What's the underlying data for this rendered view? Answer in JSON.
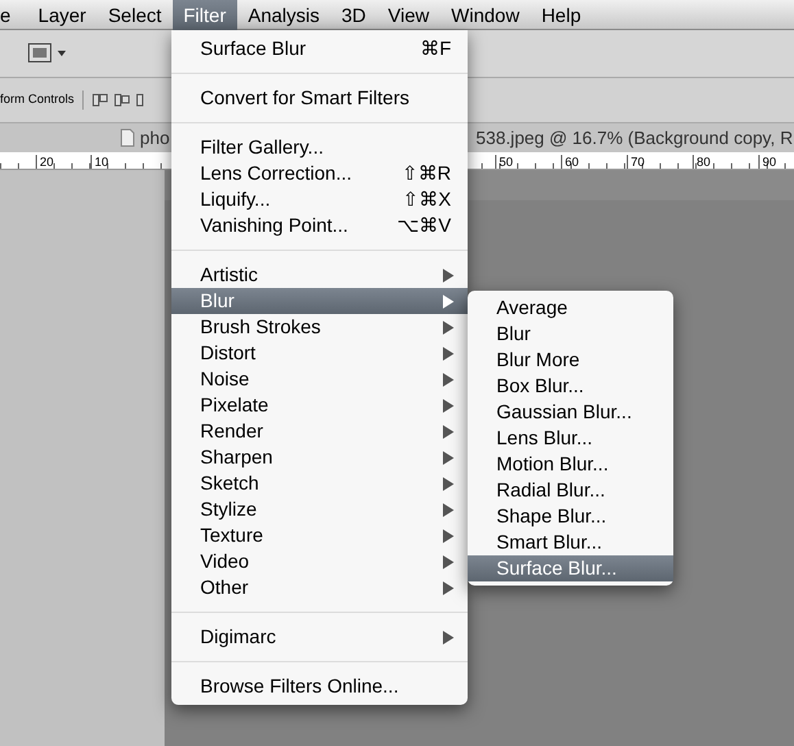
{
  "menu_bar": [
    {
      "label": "e",
      "selected": false
    },
    {
      "label": "Layer",
      "selected": false
    },
    {
      "label": "Select",
      "selected": false
    },
    {
      "label": "Filter",
      "selected": true
    },
    {
      "label": "Analysis",
      "selected": false
    },
    {
      "label": "3D",
      "selected": false
    },
    {
      "label": "View",
      "selected": false
    },
    {
      "label": "Window",
      "selected": false
    },
    {
      "label": "Help",
      "selected": false
    }
  ],
  "options_bar": {
    "label": "form Controls"
  },
  "document_tab": {
    "title_start": "pho",
    "title_end": "538.jpeg @ 16.7% (Background copy, R"
  },
  "ruler": {
    "left_labels": [
      "20",
      "10"
    ],
    "right_labels": [
      "50",
      "60",
      "70",
      "80",
      "90"
    ]
  },
  "filter_menu": [
    [
      {
        "label": "Surface Blur",
        "shortcut": "⌘F",
        "submenu": false,
        "selected": false
      }
    ],
    [
      {
        "label": "Convert for Smart Filters",
        "submenu": false,
        "selected": false
      }
    ],
    [
      {
        "label": "Filter Gallery...",
        "submenu": false,
        "selected": false
      },
      {
        "label": "Lens Correction...",
        "shortcut": "⇧⌘R",
        "submenu": false,
        "selected": false
      },
      {
        "label": "Liquify...",
        "shortcut": "⇧⌘X",
        "submenu": false,
        "selected": false
      },
      {
        "label": "Vanishing Point...",
        "shortcut": "⌥⌘V",
        "submenu": false,
        "selected": false
      }
    ],
    [
      {
        "label": "Artistic",
        "submenu": true,
        "selected": false
      },
      {
        "label": "Blur",
        "submenu": true,
        "selected": true
      },
      {
        "label": "Brush Strokes",
        "submenu": true,
        "selected": false
      },
      {
        "label": "Distort",
        "submenu": true,
        "selected": false
      },
      {
        "label": "Noise",
        "submenu": true,
        "selected": false
      },
      {
        "label": "Pixelate",
        "submenu": true,
        "selected": false
      },
      {
        "label": "Render",
        "submenu": true,
        "selected": false
      },
      {
        "label": "Sharpen",
        "submenu": true,
        "selected": false
      },
      {
        "label": "Sketch",
        "submenu": true,
        "selected": false
      },
      {
        "label": "Stylize",
        "submenu": true,
        "selected": false
      },
      {
        "label": "Texture",
        "submenu": true,
        "selected": false
      },
      {
        "label": "Video",
        "submenu": true,
        "selected": false
      },
      {
        "label": "Other",
        "submenu": true,
        "selected": false
      }
    ],
    [
      {
        "label": "Digimarc",
        "submenu": true,
        "selected": false
      }
    ],
    [
      {
        "label": "Browse Filters Online...",
        "submenu": false,
        "selected": false
      }
    ]
  ],
  "blur_submenu": [
    {
      "label": "Average",
      "selected": false
    },
    {
      "label": "Blur",
      "selected": false
    },
    {
      "label": "Blur More",
      "selected": false
    },
    {
      "label": "Box Blur...",
      "selected": false
    },
    {
      "label": "Gaussian Blur...",
      "selected": false
    },
    {
      "label": "Lens Blur...",
      "selected": false
    },
    {
      "label": "Motion Blur...",
      "selected": false
    },
    {
      "label": "Radial Blur...",
      "selected": false
    },
    {
      "label": "Shape Blur...",
      "selected": false
    },
    {
      "label": "Smart Blur...",
      "selected": false
    },
    {
      "label": "Surface Blur...",
      "selected": true
    }
  ]
}
